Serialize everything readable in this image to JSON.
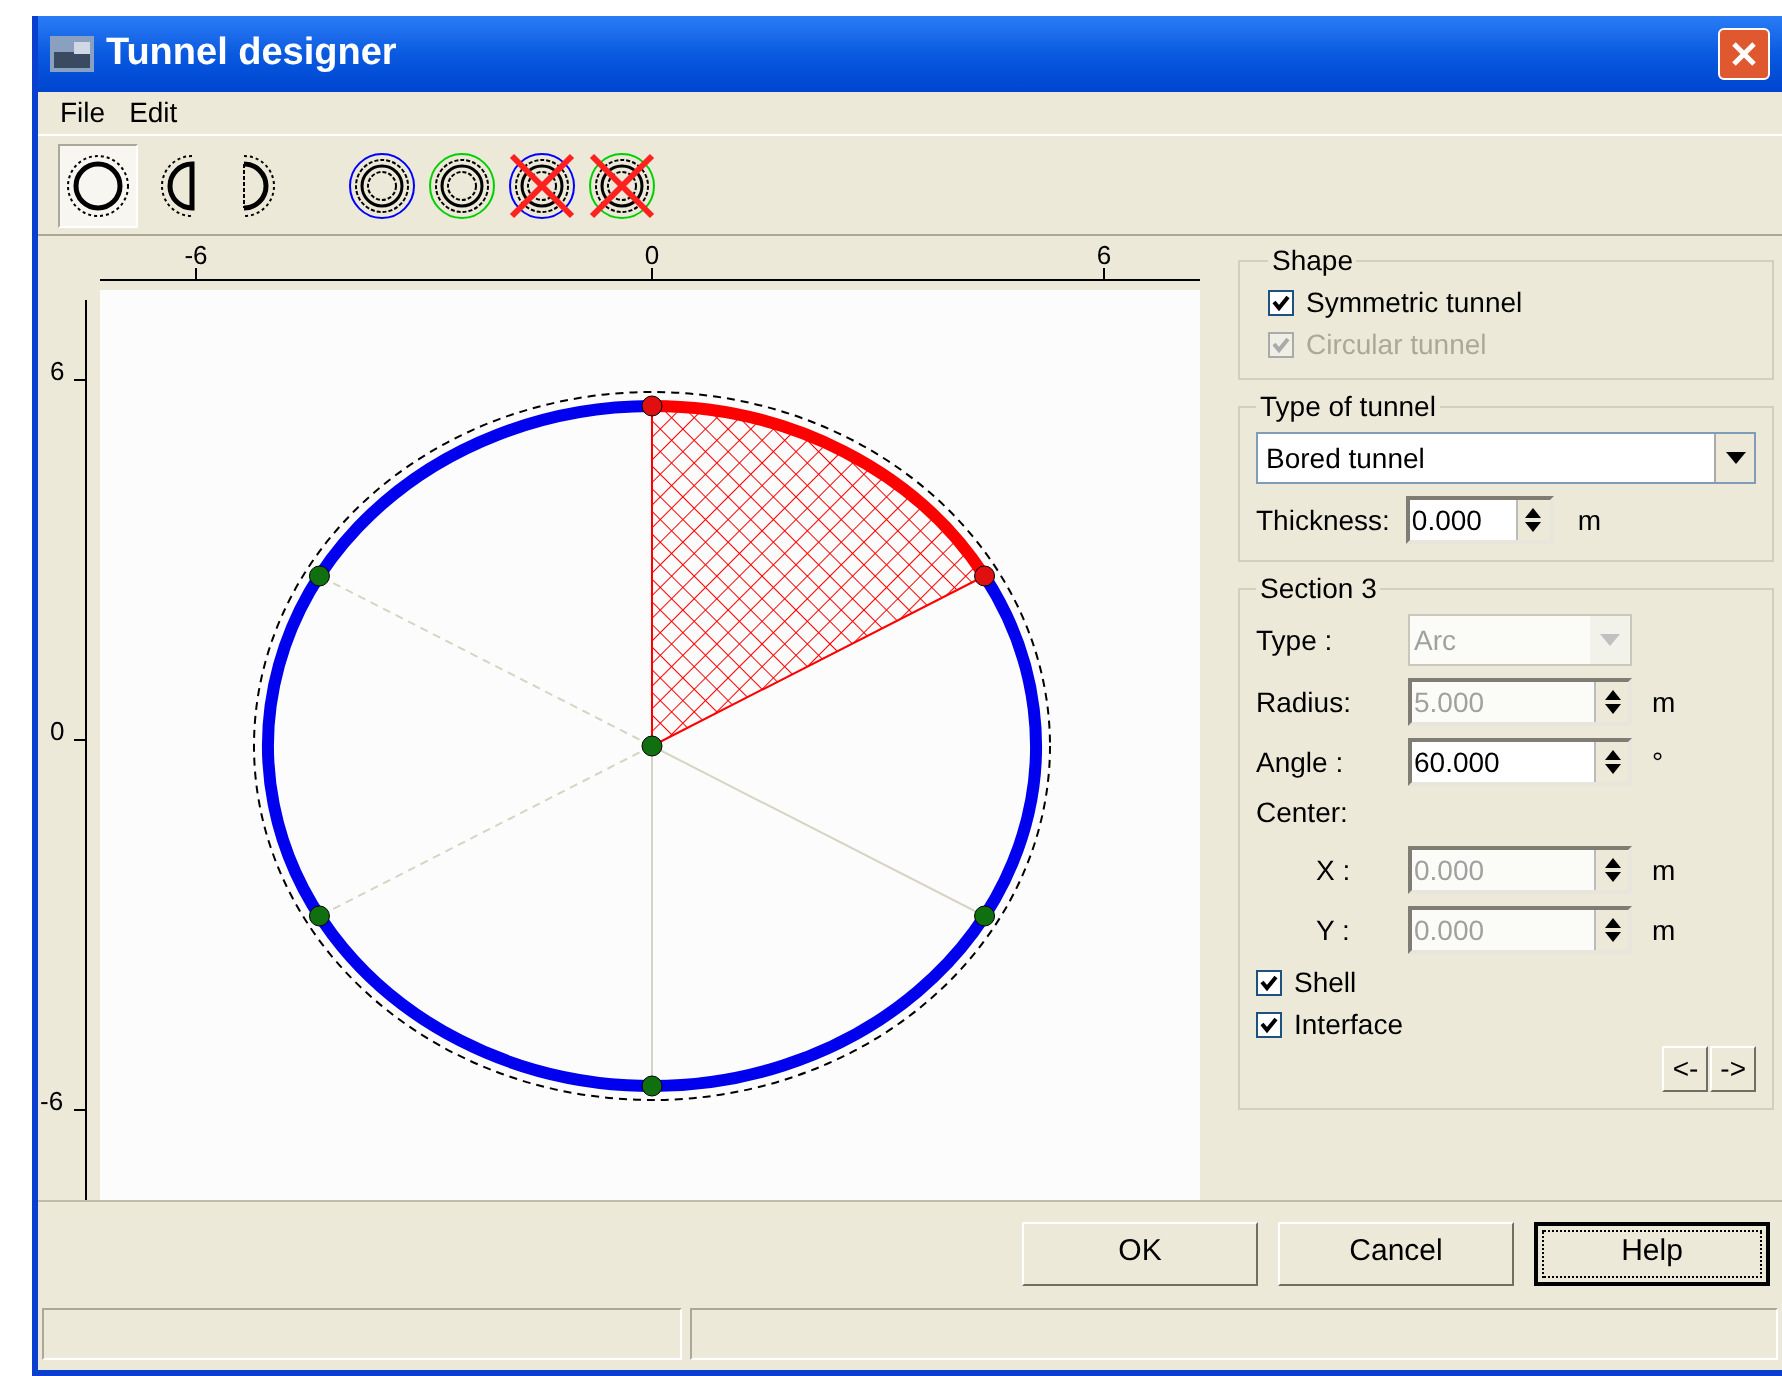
{
  "window": {
    "title": "Tunnel designer"
  },
  "menu": [
    "File",
    "Edit"
  ],
  "toolbar": [
    {
      "kind": "full",
      "selected": true
    },
    {
      "kind": "left-half",
      "selected": false
    },
    {
      "kind": "right-half",
      "selected": false
    },
    {
      "kind": "ring-blue",
      "selected": false
    },
    {
      "kind": "ring-green",
      "selected": false
    },
    {
      "kind": "ring-blue-crossed",
      "selected": false
    },
    {
      "kind": "ring-green-crossed",
      "selected": false
    }
  ],
  "canvas": {
    "x_ticks": [
      "-6",
      "0",
      "6"
    ],
    "y_ticks": [
      "6",
      "0",
      "-6"
    ]
  },
  "shape": {
    "title": "Shape",
    "options": [
      {
        "label": "Symmetric tunnel",
        "checked": true,
        "disabled": false
      },
      {
        "label": "Circular tunnel",
        "checked": true,
        "disabled": true
      }
    ]
  },
  "type_of_tunnel": {
    "title": "Type of tunnel",
    "value": "Bored tunnel",
    "thickness": {
      "label": "Thickness:",
      "value": "0.000",
      "unit": "m"
    }
  },
  "section": {
    "title": "Section 3",
    "fields": [
      {
        "kind": "dropdown",
        "label": "Type :",
        "value": "Arc",
        "disabled": true
      },
      {
        "kind": "spinner",
        "label": "Radius:",
        "value": "5.000",
        "unit": "m",
        "disabled": true
      },
      {
        "kind": "spinner",
        "label": "Angle :",
        "value": "60.000",
        "unit": "°",
        "disabled": false
      },
      {
        "kind": "heading",
        "label": "Center:"
      },
      {
        "kind": "sub-spinner",
        "label": "X :",
        "value": "0.000",
        "unit": "m",
        "disabled": true
      },
      {
        "kind": "sub-spinner",
        "label": "Y :",
        "value": "0.000",
        "unit": "m",
        "disabled": true
      }
    ],
    "options": [
      {
        "label": "Shell",
        "checked": true
      },
      {
        "label": "Interface",
        "checked": true
      }
    ],
    "nav": [
      "<-",
      "->"
    ]
  },
  "buttons": [
    {
      "label": "OK",
      "focused": false
    },
    {
      "label": "Cancel",
      "focused": false
    },
    {
      "label": "Help",
      "focused": true
    }
  ]
}
